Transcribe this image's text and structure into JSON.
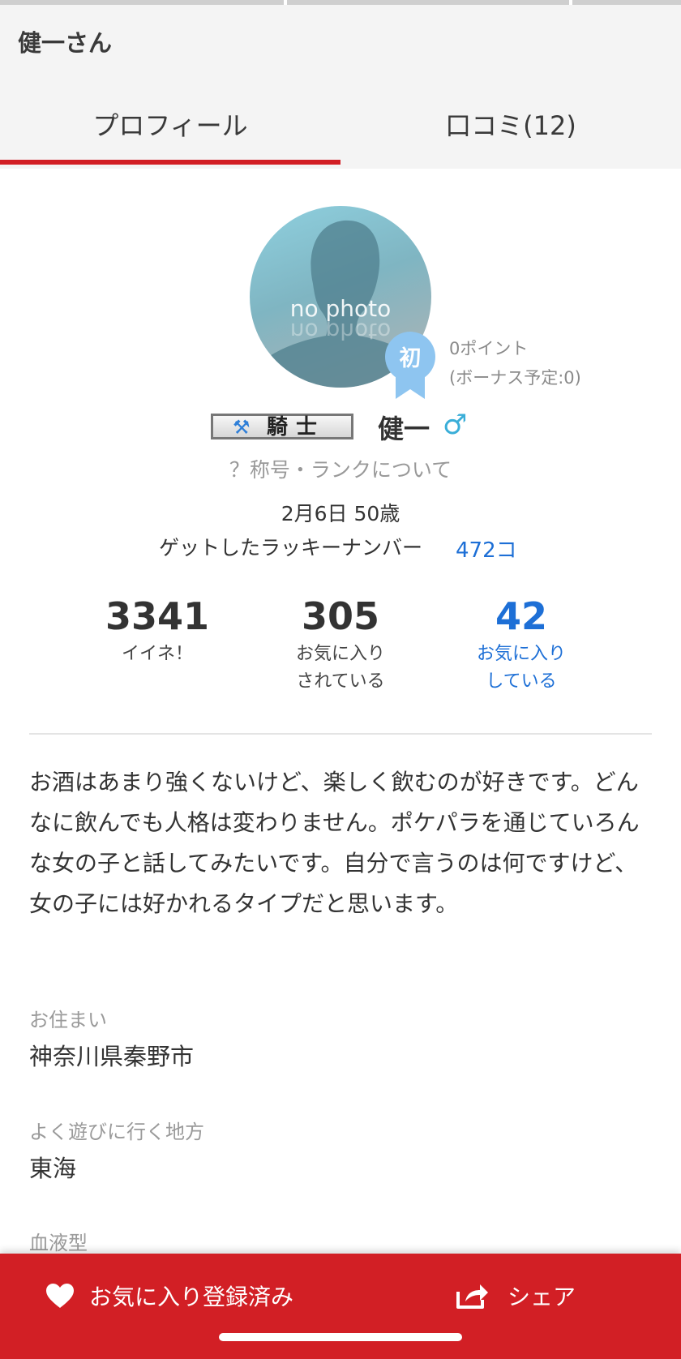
{
  "header": {
    "title": "健一さん",
    "tabs": [
      {
        "label": "プロフィール",
        "active": true
      },
      {
        "label": "口コミ(12)",
        "active": false
      }
    ]
  },
  "profile": {
    "avatar_text": "no photo",
    "badge": "初",
    "points": "0ポイント",
    "bonus": "(ボーナス予定:0)",
    "rank_icon": "crossed-axes-icon",
    "rank_label": "騎士",
    "name": "健一",
    "gender_symbol": "♂",
    "rank_info_link": "？称号・ランクについて",
    "birthday_age": "2月6日 50歳",
    "lucky_label": "ゲットしたラッキーナンバー",
    "lucky_value": "472コ"
  },
  "stats": [
    {
      "number": "3341",
      "label_line1": "イイネ！",
      "label_line2": ""
    },
    {
      "number": "305",
      "label_line1": "お気に入り",
      "label_line2": "されている"
    },
    {
      "number": "42",
      "label_line1": "お気に入り",
      "label_line2": "している"
    }
  ],
  "bio": "お酒はあまり強くないけど、楽しく飲むのが好きです。どんなに飲んでも人格は変わりません。ポケパラを通じていろんな女の子と話してみたいです。自分で言うのは何ですけど、女の子には好かれるタイプだと思います。",
  "fields": [
    {
      "label": "お住まい",
      "value": "神奈川県秦野市"
    },
    {
      "label": "よく遊びに行く地方",
      "value": "東海"
    },
    {
      "label": "血液型",
      "value": ""
    }
  ],
  "bottom_bar": {
    "favorite_label": "お気に入り登録済み",
    "share_label": "シェア"
  },
  "colors": {
    "accent_red": "#d21f25",
    "link_blue": "#1d6fd6",
    "gender_blue": "#3aaed8"
  }
}
